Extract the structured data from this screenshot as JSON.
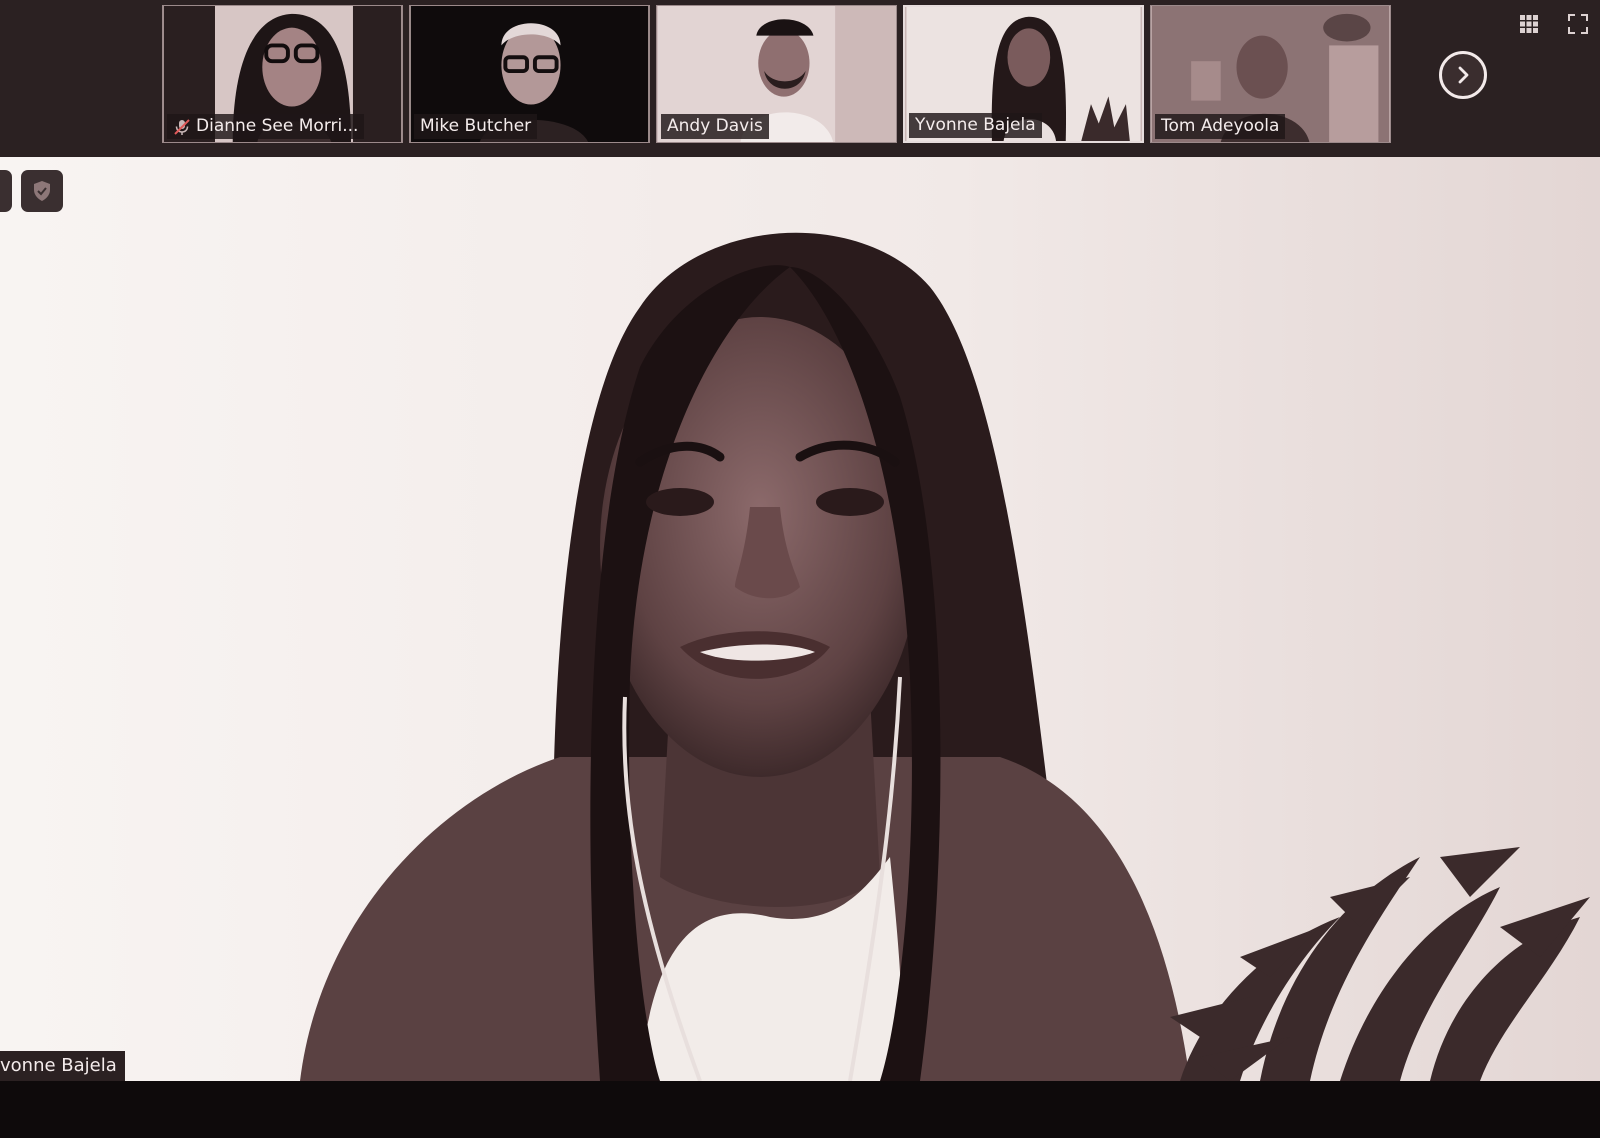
{
  "participants": [
    {
      "name": "Dianne See Morri...",
      "muted": true,
      "icon": "microphone-muted-icon"
    },
    {
      "name": "Mike Butcher",
      "muted": false
    },
    {
      "name": "Andy Davis",
      "muted": false
    },
    {
      "name": "Yvonne Bajela",
      "muted": false,
      "active": true
    },
    {
      "name": "Tom Adeyoola",
      "muted": false
    }
  ],
  "strip_controls": {
    "next_icon": "chevron-right-icon",
    "grid_icon": "gallery-grid-icon",
    "fullscreen_icon": "fullscreen-icon"
  },
  "main": {
    "speaker_label": "vonne Bajela",
    "security_icon": "shield-icon"
  },
  "colors": {
    "strip_bg": "#2b2122",
    "wall": "#f6f1ef",
    "tint": "#8a6f70",
    "bottom_bar": "#0e0a0b"
  }
}
